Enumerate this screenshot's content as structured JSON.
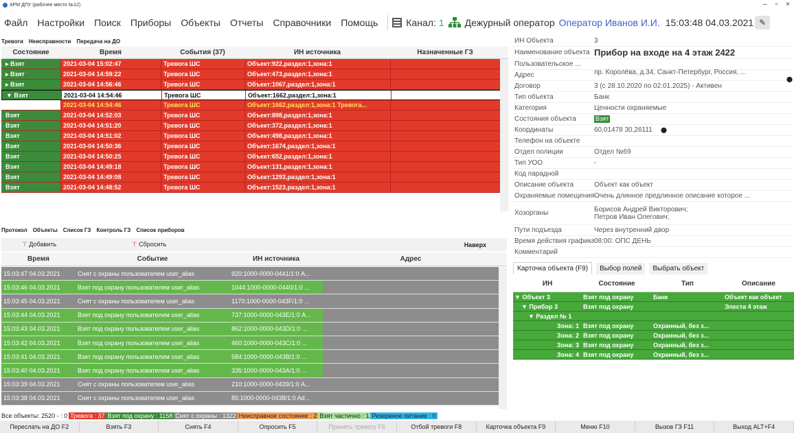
{
  "window": {
    "title": "АРМ ДПУ (рабочее место №12)"
  },
  "menu": [
    "Файл",
    "Настройки",
    "Поиск",
    "Приборы",
    "Объекты",
    "Отчеты",
    "Справочники",
    "Помощь"
  ],
  "header": {
    "channel_label": "Канал:",
    "channel_value": "1",
    "role": "Дежурный оператор",
    "operator": "Оператор Иванов И.И.",
    "datetime": "15:03:48 04.03.2021"
  },
  "alarm_tabs": [
    "Тревоги",
    "Неисправности",
    "Передача на ДО"
  ],
  "alarm_grid": {
    "columns": [
      "Состояние",
      "Время",
      "События (37)",
      "ИН источника",
      "Назначенные ГЗ"
    ],
    "rows": [
      [
        "Взят",
        "2021-03-04 15:02:47",
        "Тревога ШС",
        "Объект:922,раздел:1,зона:1"
      ],
      [
        "Взят",
        "2021-03-04 14:59:22",
        "Тревога ШС",
        "Объект:473,раздел:1,зона:1"
      ],
      [
        "Взят",
        "2021-03-04 14:56:46",
        "Тревога ШС",
        "Объект:1067,раздел:1,зона:1"
      ],
      [
        "Взят",
        "2021-03-04 14:54:46",
        "Тревога ШС",
        "Объект:1662,раздел:1,зона:1"
      ],
      [
        "",
        "2021-03-04 14:54:46",
        "Тревога ШС",
        "Объект:1662,раздел:1,зона:1 Тревога..."
      ],
      [
        "Взят",
        "2021-03-04 14:52:03",
        "Тревога ШС",
        "Объект:898,раздел:1,зона:1"
      ],
      [
        "Взят",
        "2021-03-04 14:51:20",
        "Тревога ШС",
        "Объект:372,раздел:1,зона:1"
      ],
      [
        "Взят",
        "2021-03-04 14:51:02",
        "Тревога ШС",
        "Объект:498,раздел:1,зона:1"
      ],
      [
        "Взят",
        "2021-03-04 14:50:36",
        "Тревога ШС",
        "Объект:1674,раздел:1,зона:1"
      ],
      [
        "Взят",
        "2021-03-04 14:50:25",
        "Тревога ШС",
        "Объект:652,раздел:1,зона:1"
      ],
      [
        "Взят",
        "2021-03-04 14:49:18",
        "Тревога ШС",
        "Объект:131,раздел:1,зона:1"
      ],
      [
        "Взят",
        "2021-03-04 14:49:08",
        "Тревога ШС",
        "Объект:1293,раздел:1,зона:1"
      ],
      [
        "Взят",
        "2021-03-04 14:48:52",
        "Тревога ШС",
        "Объект:1523,раздел:1,зона:1"
      ]
    ]
  },
  "protocol_tabs": [
    "Протокол",
    "Объекты",
    "Список ГЗ",
    "Контроль ГЗ",
    "Список приборов"
  ],
  "protocol_toolbar": {
    "add": "Добавить",
    "reset": "Сбросить",
    "top": "Наверх"
  },
  "protocol": {
    "columns": [
      "Время",
      "Событие",
      "ИН источника",
      "Адрес"
    ],
    "rows": [
      {
        "t": "15:03:47 04.03.2021",
        "e": "Снят с охраны пользователем user_alias",
        "s": "920:1000-0000-0441/1:0 А...",
        "g": false
      },
      {
        "t": "15:03:46 04.03.2021",
        "e": "Взят под охрану пользователем user_alias",
        "s": "1044:1000-0000-0440/1:0 ...",
        "g": true
      },
      {
        "t": "15:03:45 04.03.2021",
        "e": "Снят с охраны пользователем user_alias",
        "s": "1170:1000-0000-043F/1:0 ...",
        "g": false
      },
      {
        "t": "15:03:44 04.03.2021",
        "e": "Взят под охрану пользователем user_alias",
        "s": "737:1000-0000-043E/1:0 А...",
        "g": true
      },
      {
        "t": "15:03:43 04.03.2021",
        "e": "Взят под охрану пользователем user_alias",
        "s": "862:1000-0000-043D/1:0 ...",
        "g": true
      },
      {
        "t": "15:03:42 04.03.2021",
        "e": "Взят под охрану пользователем user_alias",
        "s": "460:1000-0000-043C/1:0 ...",
        "g": true
      },
      {
        "t": "15:03:41 04.03.2021",
        "e": "Взят под охрану пользователем user_alias",
        "s": "584:1000-0000-043B/1:0 ...",
        "g": true
      },
      {
        "t": "15:03:40 04.03.2021",
        "e": "Взят под охрану пользователем user_alias",
        "s": "335:1000-0000-043A/1:0 ...",
        "g": true
      },
      {
        "t": "15:03:39 04.03.2021",
        "e": "Снят с охраны пользователем user_alias",
        "s": "210:1000-0000-0439/1:0 А...",
        "g": false
      },
      {
        "t": "15:03:38 04.03.2021",
        "e": "Снят с охраны пользователем user_alias",
        "s": "85:1000-0000-0438/1:0 Ad...",
        "g": false
      }
    ]
  },
  "object_card": [
    [
      "ИН Объекта",
      "3"
    ],
    [
      "Наименование объекта",
      "Прибор на входе на 4 этаж 2422"
    ],
    [
      "Пользовательское ...",
      ""
    ],
    [
      "Адрес",
      "пр. Королёва, д.34, Санкт-Петербург, Россия, ..."
    ],
    [
      "Договор",
      "3  (с 28.10.2020  по 02.01.2025)  - Активен"
    ],
    [
      "Тип объекта",
      "Банк"
    ],
    [
      "Категория",
      "Ценности охраняемые"
    ],
    [
      "Состояния объекта",
      "Взят"
    ],
    [
      "Координаты",
      "60,01478 30,26111"
    ],
    [
      "Телефон на объекте",
      ""
    ],
    [
      "Отдел полиции",
      "Отдел №69"
    ],
    [
      "Тип УОО",
      "-"
    ],
    [
      "Код парадной",
      ""
    ],
    [
      "Описание объекта",
      "Объект как объект"
    ],
    [
      "Охраняемые помещения",
      "Очень длинное предлинное описание которое ..."
    ],
    [
      "Хозорганы",
      "Борисов Андрей Викторович;\nПетров Иван Олегович;"
    ],
    [
      "Пути подъезда",
      "Через внутренний двор"
    ],
    [
      "Время действия графика ...",
      "08:00: ОПС ДЕНЬ"
    ],
    [
      "Комментарий",
      ""
    ]
  ],
  "card_tabs": [
    "Карточка объекта (F9)",
    "Выбор полей",
    "Выбрать объект"
  ],
  "tree": {
    "columns": [
      "ИН",
      "Состояние",
      "Тип",
      "Описание"
    ],
    "rows": [
      [
        "▼ Объект 3",
        "Взят под охрану",
        "Банк",
        "Объект как объект"
      ],
      [
        "▼ Прибор 3",
        "Взят под охрану",
        "",
        "Элеста 4 этаж"
      ],
      [
        "▼ Раздел № 1",
        "",
        "",
        ""
      ],
      [
        "Зона: 1",
        "Взят под охрану",
        "Охранный, без з...",
        ""
      ],
      [
        "Зона: 2",
        "Взят под охрану",
        "Охранный, без з...",
        ""
      ],
      [
        "Зона: 3",
        "Взят под охрану",
        "Охранный, без з...",
        ""
      ],
      [
        "Зона: 4",
        "Взят под охрану",
        "Охранный, без з...",
        ""
      ]
    ]
  },
  "status": [
    {
      "text": "Все объекты: 2520 - : 0",
      "color": "#ffffff"
    },
    {
      "text": "Тревога : 37",
      "color": "#e23a2a"
    },
    {
      "text": "Взят под охрану : 1158",
      "color": "#3b8b3b"
    },
    {
      "text": "Снят с охраны : 1322",
      "color": "#8d8d8d"
    },
    {
      "text": "Неисправное состояние : 2",
      "color": "#f2a15a"
    },
    {
      "text": "Взят частично : 1",
      "color": "#a8e39c"
    },
    {
      "text": "Резервное питание : 0",
      "color": "#33b6e8"
    }
  ],
  "buttons": [
    "Переслать на ДО F2",
    "Взять F3",
    "Снять F4",
    "Опросить F5",
    "Принять тревогу F6",
    "Отбой тревоги F8",
    "Карточка объекта F9",
    "Меню F10",
    "Вызов ГЗ F11",
    "Выход ALT+F4"
  ]
}
